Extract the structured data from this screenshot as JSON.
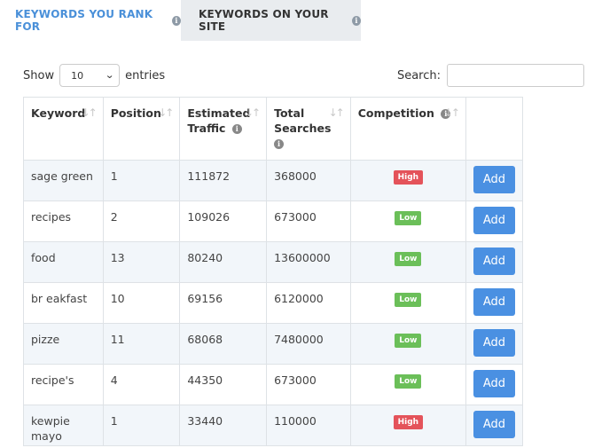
{
  "tabs": [
    {
      "label": "KEYWORDS YOU RANK FOR",
      "active": false
    },
    {
      "label": "KEYWORDS ON YOUR SITE",
      "active": true
    }
  ],
  "controls": {
    "show_label": "Show",
    "entries_value": "10",
    "entries_label": "entries",
    "search_label": "Search:",
    "search_value": ""
  },
  "table": {
    "headers": {
      "keyword": "Keyword",
      "position": "Position",
      "traffic_line1": "Estimated",
      "traffic_line2": "Traffic",
      "searches_line1": "Total",
      "searches_line2": "Searches",
      "competition": "Competition"
    },
    "rows": [
      {
        "keyword": "sage green",
        "position": "1",
        "traffic": "111872",
        "searches": "368000",
        "competition": "High",
        "action": "Add"
      },
      {
        "keyword": "recipes",
        "position": "2",
        "traffic": "109026",
        "searches": "673000",
        "competition": "Low",
        "action": "Add"
      },
      {
        "keyword": "food",
        "position": "13",
        "traffic": "80240",
        "searches": "13600000",
        "competition": "Low",
        "action": "Add"
      },
      {
        "keyword": "br eakfast",
        "position": "10",
        "traffic": "69156",
        "searches": "6120000",
        "competition": "Low",
        "action": "Add"
      },
      {
        "keyword": "pizze",
        "position": "11",
        "traffic": "68068",
        "searches": "7480000",
        "competition": "Low",
        "action": "Add"
      },
      {
        "keyword": "recipe's",
        "position": "4",
        "traffic": "44350",
        "searches": "673000",
        "competition": "Low",
        "action": "Add"
      },
      {
        "keyword": "kewpie mayo",
        "position": "1",
        "traffic": "33440",
        "searches": "110000",
        "competition": "High",
        "action": "Add"
      }
    ]
  },
  "colors": {
    "accent": "#4a90d9",
    "high": "#e4535a",
    "low": "#6bbf59",
    "button": "#4a90e2"
  }
}
